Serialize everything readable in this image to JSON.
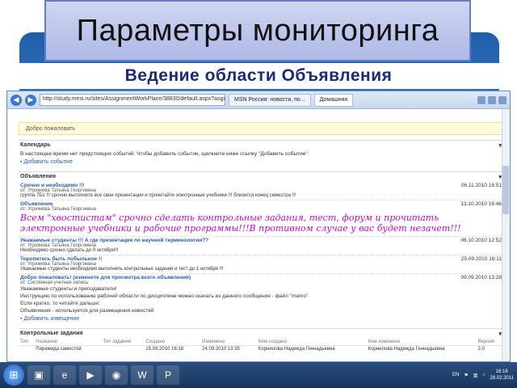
{
  "slide": {
    "title": "Параметры  мониторинга",
    "subtitle": "Ведение  области Объявления"
  },
  "browser": {
    "address": "http://study.mesi.ru/sites/AssignmentWorkPlace/38830/default.aspx?asgnbl=38830&...",
    "tabs": [
      "MSN Россия: новости, по...",
      "Домашняя"
    ],
    "nav_back_icon": "back-arrow-icon",
    "nav_forward_icon": "forward-arrow-icon"
  },
  "page": {
    "welcome": "Добро пожаловать",
    "calendar": {
      "header": "Календарь",
      "text": "В настоящее время нет предстоящих событий. Чтобы добавить событие, щелкните ниже ссылку \"Добавить событие\".",
      "add_link": "Добавить событие"
    },
    "announcements": {
      "header": "Объявления",
      "items": [
        {
          "title": "Срочно и необходимо !!!",
          "from": "от: Угрюмова Татьяна Георгиевна",
          "body": "группа 7Б1 !!! срочно выполните все свои презентации и прочитайте электронные учебники !!! близится конец семестра !!!",
          "date": "06.11.2010 16:51"
        },
        {
          "title": "Объявление",
          "from": "от: Угрюмова Татьяна Георгиевна",
          "body": "",
          "big": "Всем \"хвостистам\" срочно сделать контрольные задания, тест, форум и прочитать электронные учебники и рабочие программы!!!В противном случае у вас будет незачет!!!",
          "date": "13.10.2010 16:46"
        },
        {
          "title": "Уважаемые студенты !!! А где презентация по научной терминологии??",
          "from": "от: Угрюмова Татьяна Георгиевна",
          "body": "Необходимо срочно сделать до 9 октября!!!",
          "date": "06.10.2010 12:52"
        },
        {
          "title": "Торопитесь быть побыльное !!",
          "from": "от: Угрюмова Татьяна Георгиевна",
          "body": "Уважаемые студенты необходимо выполнить контрольные задания и тест до 1 октября !!!",
          "date": "25.09.2010 16:11"
        },
        {
          "title": "Добро пожаловать! (измените для просмотра всего объявления)",
          "from": "от: Системная учетная запись",
          "body": "Уважаемые студенты и преподаватели!",
          "date": "09.09.2010 13:28"
        }
      ],
      "extra_lines": [
        "Инструкцию по использованию рабочей области по дисциплине можно скачать из данного сообщения - файл \"memo\"",
        "Если кратко, то читайте дальше:",
        "Объявления - используется для размещения новостей"
      ],
      "add_link": "Добавить извещение"
    },
    "tasks": {
      "header": "Контрольные задания",
      "columns": [
        "Тип",
        "Название",
        "Тип задания",
        "Создано",
        "Изменено",
        "Кем создано",
        "Кем изменено",
        "Версия"
      ],
      "rows": [
        [
          "",
          "Пирамида самостой",
          "",
          "15.09.2010 16:18",
          "24.09.2010 13:35",
          "Корнилова Надежда Геннадьевна",
          "Корнилова Надежда Геннадьевна",
          "2.0"
        ]
      ]
    }
  },
  "taskbar": {
    "lang": "EN",
    "time": "16:16",
    "date": "28.02.2011"
  }
}
